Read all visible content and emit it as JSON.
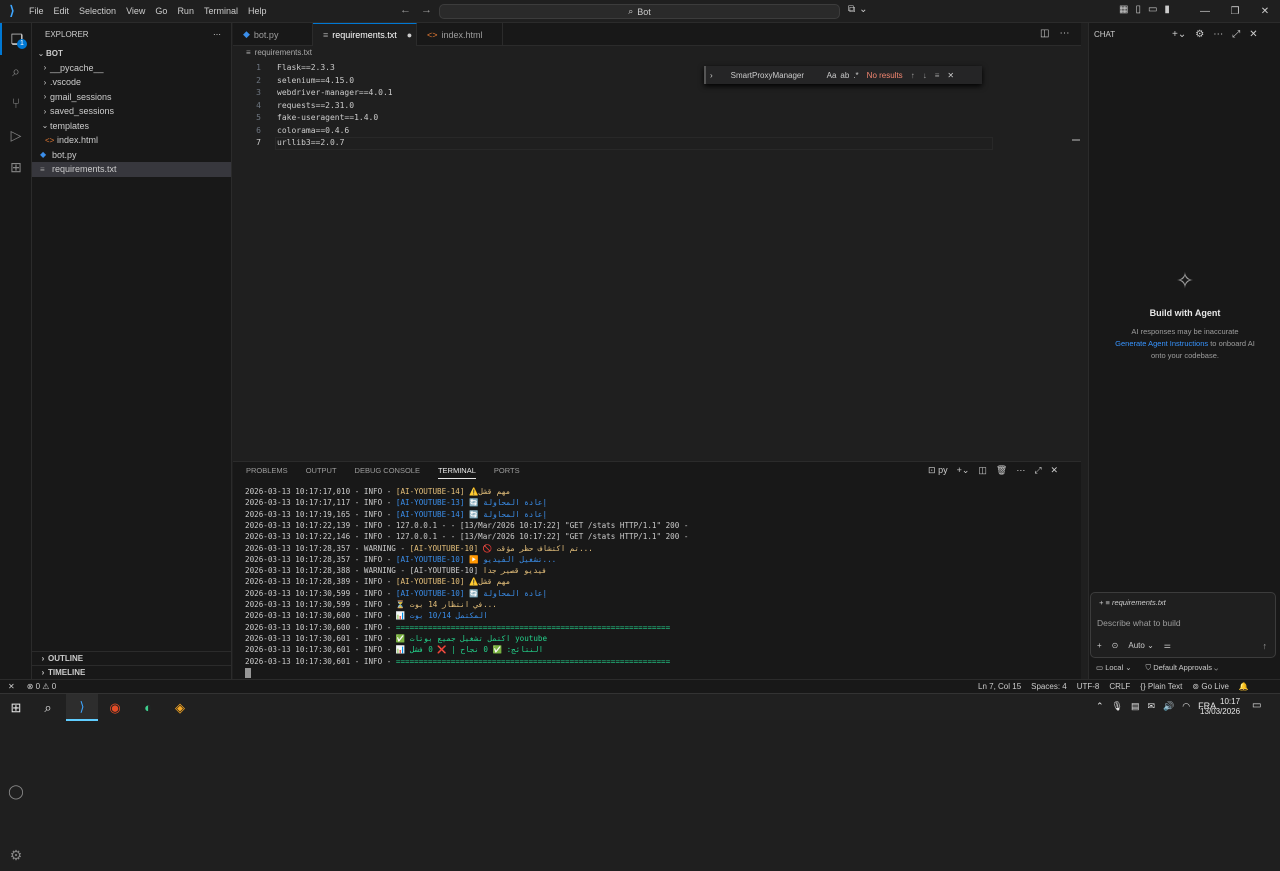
{
  "titlebar": {
    "menu": [
      "File",
      "Edit",
      "Selection",
      "View",
      "Go",
      "Run",
      "Terminal",
      "Help"
    ],
    "search": "Bot"
  },
  "sidebar": {
    "title": "EXPLORER",
    "root": "BOT",
    "items": [
      {
        "label": "__pycache__",
        "type": "folder",
        "indent": 1,
        "expanded": false
      },
      {
        "label": ".vscode",
        "type": "folder",
        "indent": 1,
        "expanded": false
      },
      {
        "label": "gmail_sessions",
        "type": "folder",
        "indent": 1,
        "expanded": false
      },
      {
        "label": "saved_sessions",
        "type": "folder",
        "indent": 1,
        "expanded": false
      },
      {
        "label": "templates",
        "type": "folder",
        "indent": 1,
        "expanded": true
      },
      {
        "label": "index.html",
        "type": "html",
        "indent": 2
      },
      {
        "label": "bot.py",
        "type": "py",
        "indent": 1
      },
      {
        "label": "requirements.txt",
        "type": "txt",
        "indent": 1,
        "selected": true
      }
    ],
    "outline": "OUTLINE",
    "timeline": "TIMELINE"
  },
  "tabs": [
    {
      "label": "bot.py",
      "icon": "python-icon",
      "active": false
    },
    {
      "label": "requirements.txt",
      "icon": "text-file-icon",
      "active": true,
      "dirty": true
    },
    {
      "label": "index.html",
      "icon": "html-icon",
      "active": false
    }
  ],
  "breadcrumb": "requirements.txt",
  "code_lines": [
    "Flask==2.3.3",
    "selenium==4.15.0",
    "webdriver-manager==4.0.1",
    "requests==2.31.0",
    "fake-useragent==1.4.0",
    "colorama==0.4.6",
    "urllib3==2.0.7"
  ],
  "line_numbers": [
    "1",
    "2",
    "3",
    "4",
    "5",
    "6",
    "7"
  ],
  "find_widget": {
    "query": "SmartProxyManager",
    "result": "No results",
    "options": [
      "Aa",
      "ab",
      ".*"
    ]
  },
  "panel": {
    "tabs": [
      "PROBLEMS",
      "OUTPUT",
      "DEBUG CONSOLE",
      "TERMINAL",
      "PORTS"
    ],
    "active_tab": "TERMINAL",
    "shell": "py"
  },
  "terminal_lines": [
    {
      "pre": "2026-03-13 10:17:17,010 - INFO - ",
      "tag": "[AI-YOUTUBE-14]",
      "tag_color": "y",
      "msg": " ⚠️مهم قشل"
    },
    {
      "pre": "2026-03-13 10:17:17,117 - INFO - ",
      "tag": "[AI-YOUTUBE-13]",
      "tag_color": "b",
      "msg": " 🔄 إعادة المحاولة"
    },
    {
      "pre": "2026-03-13 10:17:19,165 - INFO - ",
      "tag": "[AI-YOUTUBE-14]",
      "tag_color": "b",
      "msg": " 🔄 إعادة المحاولة"
    },
    {
      "pre": "2026-03-13 10:17:22,139 - INFO - 127.0.0.1 - - [13/Mar/2026 10:17:22] \"GET /stats HTTP/1.1\" 200 -",
      "tag": "",
      "tag_color": "",
      "msg": ""
    },
    {
      "pre": "2026-03-13 10:17:22,146 - INFO - 127.0.0.1 - - [13/Mar/2026 10:17:22] \"GET /stats HTTP/1.1\" 200 -",
      "tag": "",
      "tag_color": "",
      "msg": ""
    },
    {
      "pre": "2026-03-13 10:17:28,357 - WARNING - ",
      "tag": "[AI-YOUTUBE-10]",
      "tag_color": "y",
      "msg": " 🚫 تم اكتشاف حظر مؤقت..."
    },
    {
      "pre": "2026-03-13 10:17:28,357 - INFO - ",
      "tag": "[AI-YOUTUBE-10]",
      "tag_color": "b",
      "msg": " ▶️ تشغيل الفيديو..."
    },
    {
      "pre": "2026-03-13 10:17:28,388 - WARNING - [AI-YOUTUBE-10] ",
      "tag": "",
      "tag_color": "",
      "msg": "فيديو قصير جدا"
    },
    {
      "pre": "2026-03-13 10:17:28,389 - INFO - ",
      "tag": "[AI-YOUTUBE-10]",
      "tag_color": "y",
      "msg": " ⚠️مهم قشل"
    },
    {
      "pre": "2026-03-13 10:17:30,599 - INFO - ",
      "tag": "[AI-YOUTUBE-10]",
      "tag_color": "b",
      "msg": " 🔄 إعادة المحاولة"
    },
    {
      "pre": "2026-03-13 10:17:30,599 - INFO - ",
      "tag": "",
      "tag_color": "",
      "msg": "⏳ في انتظار 14 بوت..."
    },
    {
      "pre": "2026-03-13 10:17:30,600 - INFO - ",
      "tag": "",
      "tag_color": "",
      "msg": "📊 المكتمل 10/14 بوت"
    },
    {
      "pre": "2026-03-13 10:17:30,600 - INFO - ",
      "tag": "",
      "tag_color": "g",
      "msg": "============================================================"
    },
    {
      "pre": "2026-03-13 10:17:30,601 - INFO - ",
      "tag": "",
      "tag_color": "g",
      "msg": "✅ اكتمل تشغيل جميع بوتات youtube"
    },
    {
      "pre": "2026-03-13 10:17:30,601 - INFO - ",
      "tag": "",
      "tag_color": "g",
      "msg": "📊 النتائج: ✅ 0 نجاح | ❌ 0 فشل"
    },
    {
      "pre": "2026-03-13 10:17:30,601 - INFO - ",
      "tag": "",
      "tag_color": "g",
      "msg": "============================================================"
    }
  ],
  "chat": {
    "title": "CHAT",
    "heading": "Build with Agent",
    "line1": "AI responses may be inaccurate",
    "link": "Generate Agent Instructions",
    "line2a": " to onboard AI",
    "line2b": "onto your codebase.",
    "attachment": "requirements.txt",
    "placeholder": "Describe what to build",
    "mode": "Auto",
    "location": "Local",
    "approvals": "Default Approvals"
  },
  "status": {
    "problems": "⊗ 0 ⚠ 0",
    "position": "Ln 7, Col 15",
    "spaces": "Spaces: 4",
    "encoding": "UTF-8",
    "eol": "CRLF",
    "language": "Plain Text",
    "golive": "Go Live"
  },
  "taskbar": {
    "lang": "FRA",
    "time": "10:17",
    "date": "13/03/2026"
  }
}
